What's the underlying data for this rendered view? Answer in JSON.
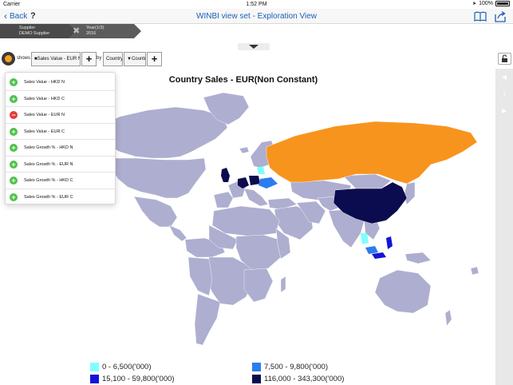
{
  "status": {
    "carrier": "Carrier",
    "time": "1:52 PM",
    "battery": "100%"
  },
  "nav": {
    "back_label": "Back",
    "help": "?",
    "title": "WINBI view set - Exploration View"
  },
  "breadcrumb": [
    {
      "label": "Supplier",
      "value": "DEMO Supplier"
    },
    {
      "label": "Year(1/3)",
      "value": "2016"
    }
  ],
  "toolbar": {
    "shows": "shows",
    "measure": "■Sales Value - EUR N",
    "plus": "+",
    "by": "by",
    "dim1": "Country",
    "dim2": "▼Country",
    "plus2": "+"
  },
  "chart_title": "Country Sales - EUR(Non Constant)",
  "menu": [
    {
      "label": "Sales Value - HKD N",
      "state": "add"
    },
    {
      "label": "Sales Value - HKD C",
      "state": "add"
    },
    {
      "label": "Sales Value - EUR N",
      "state": "remove"
    },
    {
      "label": "Sales Value - EUR C",
      "state": "add"
    },
    {
      "label": "Sales Growth % - HKD N",
      "state": "add"
    },
    {
      "label": "Sales Growth % - EUR N",
      "state": "add"
    },
    {
      "label": "Sales Growth % - HKD C",
      "state": "add"
    },
    {
      "label": "Sales Growth % - EUR C",
      "state": "add"
    }
  ],
  "legend": [
    {
      "label": "0 - 6,500('000)",
      "color": "#7fffff"
    },
    {
      "label": "7,500 - 9,800('000)",
      "color": "#2b7cf0"
    },
    {
      "label": "15,100 - 59,800('000)",
      "color": "#1414d6"
    },
    {
      "label": "116,000 - 343,300('000)",
      "color": "#0b0b4f"
    }
  ],
  "colors": {
    "default_country": "#aeaed0",
    "russia": "#f7941d",
    "accent": "#1a5fb4"
  },
  "icons": {
    "back": "chevron-left-icon",
    "book": "book-icon",
    "share": "share-icon",
    "lock": "lock-icon"
  }
}
